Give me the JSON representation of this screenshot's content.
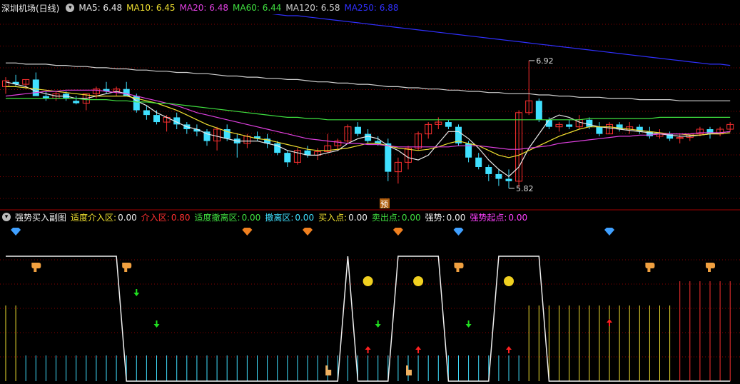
{
  "main_panel": {
    "title": "深圳机场(日线)",
    "indicators": [
      {
        "text": "MA5: 6.48",
        "color": "#e8e8e8"
      },
      {
        "text": "MA10: 6.45",
        "color": "#f0e030"
      },
      {
        "text": "MA20: 6.48",
        "color": "#e040e0"
      },
      {
        "text": "MA60: 6.44",
        "color": "#40e040"
      },
      {
        "text": "MA120: 6.58",
        "color": "#d0d0d0"
      },
      {
        "text": "MA250: 6.88",
        "color": "#3030ff"
      }
    ],
    "high_label": "6.92",
    "low_label": "5.82",
    "pre_badge": "预"
  },
  "sub_panel": {
    "title": "强势买入副图",
    "indicators": [
      {
        "name": "适度介入区:",
        "value": "0.00",
        "color": "#f0f0f0",
        "value_color": "#f0f0f0",
        "name_color": "#f0e030"
      },
      {
        "name": "介入区:",
        "value": "0.80",
        "color": "#ff3030",
        "value_color": "#ff3030",
        "name_color": "#ff3030"
      },
      {
        "name": "适度撤离区:",
        "value": "0.00",
        "color": "#40e040",
        "value_color": "#40e040",
        "name_color": "#40e040"
      },
      {
        "name": "撤离区:",
        "value": "0.00",
        "color": "#40e0ff",
        "value_color": "#40e0ff",
        "name_color": "#40e0ff"
      },
      {
        "name": "买入点:",
        "value": "0.00",
        "color": "#f0e030",
        "value_color": "#f0f0f0",
        "name_color": "#f0e030"
      },
      {
        "name": "卖出点:",
        "value": "0.00",
        "color": "#40e040",
        "value_color": "#40e040",
        "name_color": "#40e040"
      },
      {
        "name": "强势:",
        "value": "0.00",
        "color": "#f0f0f0",
        "value_color": "#f0f0f0",
        "name_color": "#f0f0f0"
      },
      {
        "name": "强势起点:",
        "value": "0.00",
        "color": "#ff40ff",
        "value_color": "#ff40ff",
        "name_color": "#ff40ff"
      }
    ]
  },
  "colors": {
    "up": "#ff3030",
    "down": "#40e0ff",
    "grid": "#8b0000",
    "text": "#dddddd",
    "ma5": "#e8e8e8",
    "ma10": "#f0e030",
    "ma20": "#e040e0",
    "ma60": "#40e040",
    "ma120": "#d0d0d0",
    "ma250": "#3030ff"
  },
  "chart_data": {
    "type": "candlestick",
    "title": "深圳机场(日线)",
    "ylim": [
      5.7,
      7.3
    ],
    "candles": [
      [
        6.7,
        6.78,
        6.64,
        6.75
      ],
      [
        6.74,
        6.8,
        6.7,
        6.72
      ],
      [
        6.72,
        6.76,
        6.68,
        6.76
      ],
      [
        6.76,
        6.82,
        6.7,
        6.62
      ],
      [
        6.62,
        6.66,
        6.58,
        6.6
      ],
      [
        6.6,
        6.66,
        6.58,
        6.64
      ],
      [
        6.64,
        6.66,
        6.58,
        6.6
      ],
      [
        6.58,
        6.62,
        6.55,
        6.56
      ],
      [
        6.56,
        6.64,
        6.5,
        6.64
      ],
      [
        6.64,
        6.7,
        6.6,
        6.68
      ],
      [
        6.68,
        6.74,
        6.64,
        6.66
      ],
      [
        6.66,
        6.7,
        6.62,
        6.68
      ],
      [
        6.68,
        6.74,
        6.62,
        6.62
      ],
      [
        6.62,
        6.64,
        6.48,
        6.5
      ],
      [
        6.5,
        6.54,
        6.42,
        6.46
      ],
      [
        6.46,
        6.5,
        6.38,
        6.4
      ],
      [
        6.4,
        6.46,
        6.32,
        6.44
      ],
      [
        6.44,
        6.48,
        6.34,
        6.38
      ],
      [
        6.38,
        6.4,
        6.3,
        6.34
      ],
      [
        6.34,
        6.38,
        6.28,
        6.32
      ],
      [
        6.32,
        6.34,
        6.2,
        6.24
      ],
      [
        6.24,
        6.36,
        6.16,
        6.34
      ],
      [
        6.34,
        6.38,
        6.24,
        6.26
      ],
      [
        6.26,
        6.3,
        6.1,
        6.22
      ],
      [
        6.22,
        6.3,
        6.18,
        6.28
      ],
      [
        6.28,
        6.32,
        6.24,
        6.26
      ],
      [
        6.26,
        6.3,
        6.18,
        6.22
      ],
      [
        6.22,
        6.24,
        6.12,
        6.14
      ],
      [
        6.14,
        6.16,
        6.02,
        6.06
      ],
      [
        6.06,
        6.18,
        6.04,
        6.16
      ],
      [
        6.16,
        6.2,
        6.1,
        6.12
      ],
      [
        6.12,
        6.18,
        6.08,
        6.15
      ],
      [
        6.15,
        6.3,
        6.14,
        6.2
      ],
      [
        6.2,
        6.26,
        6.16,
        6.24
      ],
      [
        6.24,
        6.38,
        6.22,
        6.36
      ],
      [
        6.36,
        6.4,
        6.28,
        6.3
      ],
      [
        6.3,
        6.34,
        6.22,
        6.24
      ],
      [
        6.24,
        6.28,
        6.2,
        6.22
      ],
      [
        6.22,
        6.26,
        5.9,
        5.98
      ],
      [
        5.98,
        6.1,
        5.88,
        6.06
      ],
      [
        6.06,
        6.2,
        6.0,
        6.18
      ],
      [
        6.18,
        6.32,
        6.16,
        6.3
      ],
      [
        6.3,
        6.4,
        6.26,
        6.38
      ],
      [
        6.38,
        6.44,
        6.34,
        6.4
      ],
      [
        6.4,
        6.42,
        6.34,
        6.36
      ],
      [
        6.36,
        6.38,
        6.2,
        6.22
      ],
      [
        6.22,
        6.24,
        6.06,
        6.1
      ],
      [
        6.1,
        6.14,
        6.0,
        6.02
      ],
      [
        6.02,
        6.04,
        5.9,
        5.96
      ],
      [
        5.96,
        6.0,
        5.86,
        5.92
      ],
      [
        5.92,
        6.0,
        5.84,
        5.9
      ],
      [
        5.9,
        6.5,
        5.85,
        6.48
      ],
      [
        6.48,
        6.92,
        6.46,
        6.58
      ],
      [
        6.58,
        6.6,
        6.4,
        6.42
      ],
      [
        6.42,
        6.44,
        6.34,
        6.36
      ],
      [
        6.36,
        6.4,
        6.32,
        6.38
      ],
      [
        6.38,
        6.42,
        6.34,
        6.36
      ],
      [
        6.36,
        6.46,
        6.34,
        6.42
      ],
      [
        6.42,
        6.44,
        6.34,
        6.36
      ],
      [
        6.36,
        6.4,
        6.28,
        6.3
      ],
      [
        6.3,
        6.4,
        6.3,
        6.38
      ],
      [
        6.38,
        6.4,
        6.32,
        6.34
      ],
      [
        6.34,
        6.4,
        6.3,
        6.36
      ],
      [
        6.36,
        6.38,
        6.3,
        6.32
      ],
      [
        6.32,
        6.36,
        6.26,
        6.28
      ],
      [
        6.28,
        6.34,
        6.26,
        6.3
      ],
      [
        6.3,
        6.32,
        6.24,
        6.26
      ],
      [
        6.26,
        6.3,
        6.22,
        6.27
      ],
      [
        6.27,
        6.3,
        6.24,
        6.3
      ],
      [
        6.3,
        6.36,
        6.28,
        6.34
      ],
      [
        6.34,
        6.36,
        6.26,
        6.3
      ],
      [
        6.3,
        6.36,
        6.28,
        6.34
      ],
      [
        6.34,
        6.4,
        6.32,
        6.38
      ]
    ],
    "ma_lines": {
      "MA5": [
        6.74,
        6.72,
        6.7,
        6.66,
        6.64,
        6.62,
        6.62,
        6.6,
        6.6,
        6.62,
        6.64,
        6.66,
        6.64,
        6.58,
        6.54,
        6.48,
        6.44,
        6.4,
        6.36,
        6.34,
        6.3,
        6.28,
        6.26,
        6.24,
        6.24,
        6.24,
        6.22,
        6.2,
        6.16,
        6.14,
        6.12,
        6.12,
        6.14,
        6.16,
        6.22,
        6.26,
        6.28,
        6.26,
        6.2,
        6.16,
        6.1,
        6.08,
        6.12,
        6.22,
        6.32,
        6.32,
        6.26,
        6.18,
        6.08,
        6.0,
        5.94,
        6.02,
        6.18,
        6.3,
        6.42,
        6.46,
        6.44,
        6.4,
        6.38,
        6.36,
        6.35,
        6.34,
        6.33,
        6.32,
        6.31,
        6.3,
        6.29,
        6.28,
        6.28,
        6.29,
        6.3,
        6.31,
        6.32
      ],
      "MA10": [
        6.7,
        6.7,
        6.69,
        6.68,
        6.67,
        6.66,
        6.65,
        6.64,
        6.63,
        6.62,
        6.62,
        6.62,
        6.62,
        6.6,
        6.58,
        6.56,
        6.53,
        6.5,
        6.46,
        6.42,
        6.38,
        6.35,
        6.32,
        6.3,
        6.28,
        6.26,
        6.25,
        6.23,
        6.21,
        6.19,
        6.17,
        6.16,
        6.16,
        6.17,
        6.18,
        6.2,
        6.22,
        6.22,
        6.2,
        6.18,
        6.17,
        6.16,
        6.17,
        6.19,
        6.22,
        6.24,
        6.22,
        6.2,
        6.16,
        6.12,
        6.1,
        6.12,
        6.16,
        6.2,
        6.24,
        6.28,
        6.31,
        6.34,
        6.36,
        6.36,
        6.36,
        6.35,
        6.34,
        6.33,
        6.32,
        6.31,
        6.3,
        6.3,
        6.29,
        6.29,
        6.3,
        6.3,
        6.31
      ],
      "MA20": [
        6.62,
        6.63,
        6.64,
        6.65,
        6.66,
        6.66,
        6.67,
        6.67,
        6.67,
        6.67,
        6.66,
        6.65,
        6.64,
        6.62,
        6.6,
        6.58,
        6.56,
        6.54,
        6.51,
        6.48,
        6.46,
        6.44,
        6.42,
        6.4,
        6.38,
        6.36,
        6.34,
        6.32,
        6.3,
        6.28,
        6.26,
        6.25,
        6.24,
        6.23,
        6.22,
        6.22,
        6.21,
        6.21,
        6.2,
        6.19,
        6.19,
        6.19,
        6.19,
        6.19,
        6.19,
        6.2,
        6.2,
        6.2,
        6.19,
        6.18,
        6.17,
        6.17,
        6.18,
        6.19,
        6.2,
        6.22,
        6.23,
        6.24,
        6.25,
        6.26,
        6.27,
        6.28,
        6.28,
        6.29,
        6.29,
        6.3,
        6.3,
        6.3,
        6.3,
        6.31,
        6.31,
        6.31,
        6.32
      ],
      "MA60": [
        6.6,
        6.6,
        6.6,
        6.6,
        6.6,
        6.6,
        6.6,
        6.6,
        6.59,
        6.59,
        6.59,
        6.58,
        6.58,
        6.57,
        6.57,
        6.56,
        6.56,
        6.55,
        6.54,
        6.53,
        6.52,
        6.51,
        6.5,
        6.49,
        6.48,
        6.47,
        6.46,
        6.45,
        6.44,
        6.44,
        6.43,
        6.43,
        6.42,
        6.42,
        6.42,
        6.42,
        6.42,
        6.42,
        6.42,
        6.42,
        6.42,
        6.42,
        6.42,
        6.42,
        6.42,
        6.42,
        6.42,
        6.42,
        6.42,
        6.42,
        6.42,
        6.42,
        6.42,
        6.42,
        6.42,
        6.42,
        6.42,
        6.42,
        6.43,
        6.43,
        6.43,
        6.43,
        6.43,
        6.43,
        6.43,
        6.44,
        6.44,
        6.44,
        6.44,
        6.44,
        6.44,
        6.44,
        6.44
      ],
      "MA120": [
        6.9,
        6.9,
        6.89,
        6.89,
        6.89,
        6.88,
        6.88,
        6.87,
        6.87,
        6.86,
        6.86,
        6.85,
        6.85,
        6.84,
        6.84,
        6.83,
        6.83,
        6.82,
        6.82,
        6.81,
        6.81,
        6.8,
        6.79,
        6.79,
        6.78,
        6.78,
        6.77,
        6.77,
        6.76,
        6.76,
        6.75,
        6.74,
        6.74,
        6.73,
        6.73,
        6.72,
        6.72,
        6.71,
        6.7,
        6.7,
        6.69,
        6.69,
        6.68,
        6.68,
        6.67,
        6.67,
        6.66,
        6.66,
        6.65,
        6.65,
        6.64,
        6.64,
        6.64,
        6.63,
        6.63,
        6.62,
        6.62,
        6.61,
        6.61,
        6.61,
        6.6,
        6.6,
        6.6,
        6.59,
        6.59,
        6.59,
        6.59,
        6.58,
        6.58,
        6.58,
        6.58,
        6.58,
        6.58
      ],
      "MA250": [
        7.48,
        7.47,
        7.47,
        7.46,
        7.46,
        7.45,
        7.45,
        7.44,
        7.44,
        7.43,
        7.43,
        7.42,
        7.42,
        7.41,
        7.41,
        7.4,
        7.39,
        7.39,
        7.38,
        7.37,
        7.37,
        7.36,
        7.35,
        7.34,
        7.34,
        7.33,
        7.32,
        7.31,
        7.3,
        7.3,
        7.29,
        7.28,
        7.27,
        7.26,
        7.25,
        7.24,
        7.23,
        7.22,
        7.21,
        7.2,
        7.19,
        7.18,
        7.17,
        7.16,
        7.15,
        7.14,
        7.13,
        7.12,
        7.11,
        7.1,
        7.09,
        7.08,
        7.07,
        7.06,
        7.05,
        7.04,
        7.03,
        7.02,
        7.01,
        7.0,
        6.99,
        6.98,
        6.97,
        6.96,
        6.95,
        6.94,
        6.93,
        6.92,
        6.91,
        6.9,
        6.89,
        6.89,
        6.88
      ]
    },
    "sub": {
      "strong_line": [
        1,
        1,
        1,
        1,
        1,
        1,
        1,
        1,
        1,
        1,
        1,
        1,
        0,
        0,
        0,
        0,
        0,
        0,
        0,
        0,
        0,
        0,
        0,
        0,
        0,
        0,
        0,
        0,
        0,
        0,
        0,
        0,
        0,
        0,
        1,
        0,
        0,
        0,
        0,
        1,
        1,
        1,
        1,
        1,
        0,
        0,
        0,
        0,
        0,
        1,
        1,
        1,
        1,
        1,
        0,
        0,
        0,
        0,
        0,
        0,
        0,
        0,
        0,
        0,
        0,
        0,
        0,
        0,
        0,
        0,
        0,
        0,
        0
      ],
      "bar_type": [
        "y",
        "y",
        "c",
        "c",
        "c",
        "c",
        "c",
        "c",
        "c",
        "c",
        "c",
        "c",
        "c",
        "c",
        "c",
        "c",
        "c",
        "c",
        "c",
        "c",
        "c",
        "c",
        "c",
        "c",
        "c",
        "c",
        "c",
        "c",
        "c",
        "c",
        "c",
        "c",
        "c",
        "c",
        "c",
        "c",
        "c",
        "c",
        "c",
        "c",
        "c",
        "c",
        "c",
        "c",
        "c",
        "c",
        "c",
        "c",
        "c",
        "c",
        "c",
        "c",
        "y",
        "y",
        "y",
        "y",
        "y",
        "y",
        "y",
        "y",
        "y",
        "y",
        "y",
        "y",
        "y",
        "y",
        "y",
        "r",
        "r",
        "r",
        "r",
        "r",
        "r"
      ]
    }
  }
}
